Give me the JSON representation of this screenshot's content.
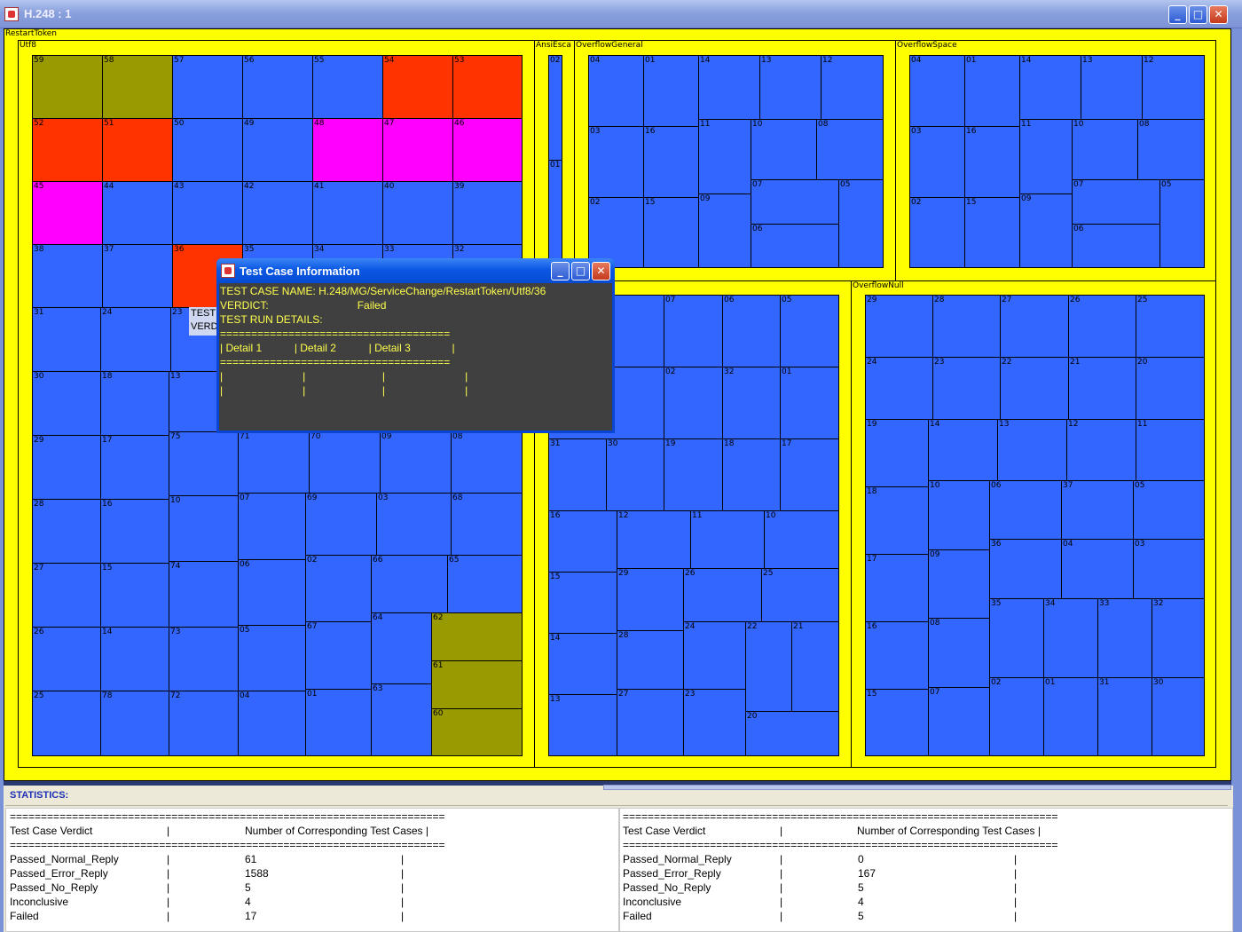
{
  "window": {
    "title": "H.248 : 1",
    "controls": [
      "_",
      "□",
      "✕"
    ]
  },
  "colors": {
    "frame": "#ffff00",
    "pass": "#3366ff",
    "fail": "#ff3300",
    "inconclusive": "#ff00ff",
    "no_reply": "#999900"
  },
  "treemap": {
    "root": "RestartToken",
    "groups": [
      "Utf8",
      "AnsiEsca",
      "OverflowGeneral",
      "OverflowSpace",
      "OverflowNull"
    ],
    "utf8": [
      "59",
      "58",
      "57",
      "56",
      "55",
      "54",
      "53",
      "52",
      "51",
      "50",
      "49",
      "48",
      "47",
      "46",
      "45",
      "44",
      "43",
      "42",
      "41",
      "40",
      "39",
      "38",
      "37",
      "36",
      "35",
      "34",
      "33",
      "32",
      "31",
      "24",
      "23",
      "30",
      "18",
      "13",
      "29",
      "17",
      "75",
      "71",
      "70",
      "09",
      "08",
      "28",
      "16",
      "10",
      "07",
      "69",
      "03",
      "68",
      "27",
      "15",
      "74",
      "06",
      "02",
      "66",
      "65",
      "26",
      "14",
      "73",
      "05",
      "67",
      "64",
      "62",
      "61",
      "25",
      "78",
      "72",
      "04",
      "01",
      "63",
      "60"
    ],
    "ansi": [
      "02",
      "01"
    ],
    "overflow_general": [
      "04",
      "01",
      "14",
      "13",
      "12",
      "03",
      "16",
      "11",
      "10",
      "08",
      "07",
      "05",
      "06",
      "02",
      "15",
      "09"
    ],
    "overflow_space": [
      "04",
      "01",
      "14",
      "13",
      "12",
      "03",
      "16",
      "11",
      "10",
      "08",
      "07",
      "05",
      "06",
      "02",
      "15",
      "09"
    ],
    "bottom_mid": [
      "07",
      "06",
      "05",
      "02",
      "32",
      "01",
      "31",
      "30",
      "19",
      "18",
      "17",
      "16",
      "12",
      "11",
      "10",
      "15",
      "29",
      "26",
      "25",
      "14",
      "28",
      "24",
      "22",
      "21",
      "13",
      "27",
      "23",
      "20"
    ],
    "overflow_null": [
      "29",
      "28",
      "27",
      "26",
      "25",
      "24",
      "23",
      "22",
      "21",
      "20",
      "19",
      "14",
      "13",
      "12",
      "11",
      "18",
      "10",
      "06",
      "37",
      "05",
      "36",
      "04",
      "03",
      "17",
      "09",
      "35",
      "34",
      "33",
      "32",
      "16",
      "08",
      "02",
      "01",
      "31",
      "30",
      "15",
      "07"
    ]
  },
  "behind_text": [
    "TEST",
    "VERD"
  ],
  "dialog": {
    "title": "Test Case Information",
    "lines": [
      "TEST CASE NAME: H.248/MG/ServiceChange/RestartToken/Utf8/36",
      "VERDICT:                              Failed",
      "TEST RUN DETAILS:",
      "=====================================",
      "| Detail 1           | Detail 2           | Detail 3              |",
      "=====================================",
      "|                           |                          |                           |",
      "|                           |                          |                           |"
    ]
  },
  "statistics": {
    "title": "STATISTICS:",
    "separator": "======================================================================",
    "col_verdict": "Test Case Verdict",
    "col_count": "Number of Corresponding Test Cases |",
    "pipe": "|",
    "left": {
      "rows": [
        {
          "verdict": "Passed_Normal_Reply",
          "count": "61"
        },
        {
          "verdict": "Passed_Error_Reply",
          "count": "1588"
        },
        {
          "verdict": "Passed_No_Reply",
          "count": "5"
        },
        {
          "verdict": "Inconclusive",
          "count": "4"
        },
        {
          "verdict": "Failed",
          "count": "17"
        }
      ]
    },
    "right": {
      "rows": [
        {
          "verdict": "Passed_Normal_Reply",
          "count": "0"
        },
        {
          "verdict": "Passed_Error_Reply",
          "count": "167"
        },
        {
          "verdict": "Passed_No_Reply",
          "count": "5"
        },
        {
          "verdict": "Inconclusive",
          "count": "4"
        },
        {
          "verdict": "Failed",
          "count": "5"
        }
      ]
    }
  }
}
